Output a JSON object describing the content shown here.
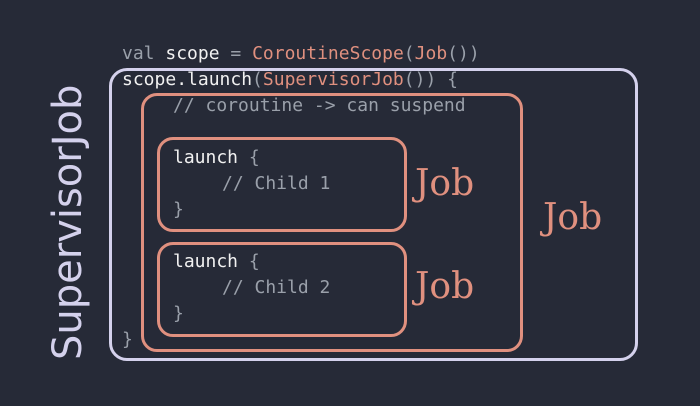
{
  "code": {
    "line1": {
      "kw": "val",
      "name": "scope",
      "eq": "=",
      "ctor": "CoroutineScope",
      "paren_open": "(",
      "job": "Job",
      "parens": "())"
    },
    "line2": {
      "scope": "scope",
      "launch": ".launch",
      "paren_open": "(",
      "sup": "SupervisorJob",
      "parens": "())",
      "brace": "{"
    },
    "comment": "// coroutine -> can suspend",
    "child1": {
      "launch": "launch",
      "brace_open": "{",
      "comment": "// Child 1",
      "brace_close": "}"
    },
    "child2": {
      "launch": "launch",
      "brace_open": "{",
      "comment": "// Child 2",
      "brace_close": "}"
    },
    "closing_brace": "}"
  },
  "labels": {
    "vertical": "SupervisorJob",
    "job_child1": "Job",
    "job_child2": "Job",
    "job_outer": "Job"
  },
  "colors": {
    "background": "#262a37",
    "supervisor_outline": "#d4d1ec",
    "job_outline": "#e0907f",
    "code_text": "#f1f1f1",
    "code_muted": "#9aa0aa"
  }
}
